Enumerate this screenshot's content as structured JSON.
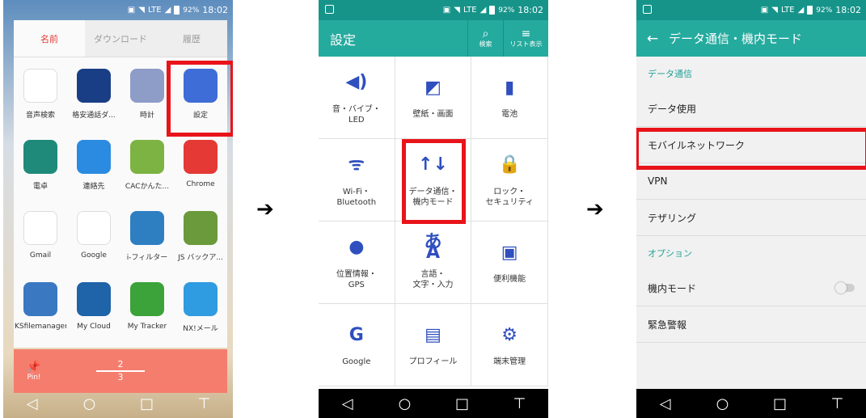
{
  "status": {
    "battery": "92%",
    "time": "18:02",
    "lte": "LTE"
  },
  "screen1": {
    "tabs": [
      "名前",
      "ダウンロード",
      "履歴"
    ],
    "apps": [
      {
        "label": "音声検索",
        "icon": "microphone-icon",
        "color": "#ffffff"
      },
      {
        "label": "格安通話ダ...",
        "icon": "phone-call-icon",
        "color": "#1a3e86"
      },
      {
        "label": "時計",
        "icon": "clock-icon",
        "color": "#8e9cc8"
      },
      {
        "label": "設定",
        "icon": "gear-icon",
        "color": "#3f6dd8"
      },
      {
        "label": "電卓",
        "icon": "calculator-icon",
        "color": "#1f8a7a"
      },
      {
        "label": "連絡先",
        "icon": "contacts-icon",
        "color": "#2b8be0"
      },
      {
        "label": "CACかんた...",
        "icon": "cac-app-icon",
        "color": "#7cb342"
      },
      {
        "label": "Chrome",
        "icon": "chrome-icon",
        "color": "#e53935"
      },
      {
        "label": "Gmail",
        "icon": "gmail-icon",
        "color": "#ffffff"
      },
      {
        "label": "Google",
        "icon": "google-icon",
        "color": "#ffffff"
      },
      {
        "label": "i-フィルター",
        "icon": "i-filter-icon",
        "color": "#2e7fc2"
      },
      {
        "label": "JS バックア...",
        "icon": "js-backup-icon",
        "color": "#6a9a3b"
      },
      {
        "label": "KSfilemanager",
        "icon": "folder-icon",
        "color": "#3a78c2"
      },
      {
        "label": "My Cloud",
        "icon": "cloud-icon",
        "color": "#1f63a8"
      },
      {
        "label": "My Tracker",
        "icon": "tracker-icon",
        "color": "#3ca33a"
      },
      {
        "label": "NX!メール",
        "icon": "mail-icon",
        "color": "#2f9be0"
      }
    ],
    "pin_label": "Pin!",
    "page_top": "2",
    "page_bottom": "3"
  },
  "screen2": {
    "title": "設定",
    "search_label": "検索",
    "list_label": "リスト表示",
    "items": [
      {
        "label": "音・バイブ・\nLED",
        "icon": "speaker-icon",
        "glyph": "◀)"
      },
      {
        "label": "壁紙・画面",
        "icon": "wallpaper-icon",
        "glyph": "◩"
      },
      {
        "label": "電池",
        "icon": "battery-icon",
        "glyph": "▮"
      },
      {
        "label": "Wi-Fi・\nBluetooth",
        "icon": "wifi-bluetooth-icon",
        "glyph": "ᯤ"
      },
      {
        "label": "データ通信・\n機内モード",
        "icon": "data-transfer-icon",
        "glyph": "↑↓"
      },
      {
        "label": "ロック・\nセキュリティ",
        "icon": "lock-icon",
        "glyph": "🔒"
      },
      {
        "label": "位置情報・\nGPS",
        "icon": "location-icon",
        "glyph": "●"
      },
      {
        "label": "言語・\n文字・入力",
        "icon": "language-icon",
        "glyph": "あA"
      },
      {
        "label": "便利機能",
        "icon": "toolbox-icon",
        "glyph": "▣"
      },
      {
        "label": "Google",
        "icon": "google-g-icon",
        "glyph": "G"
      },
      {
        "label": "プロフィール",
        "icon": "profile-card-icon",
        "glyph": "▤"
      },
      {
        "label": "端末管理",
        "icon": "device-admin-icon",
        "glyph": "⚙"
      }
    ]
  },
  "screen3": {
    "title": "データ通信・機内モード",
    "section1": "データ通信",
    "rows1": [
      "データ使用",
      "モバイルネットワーク",
      "VPN",
      "テザリング"
    ],
    "section2": "オプション",
    "airplane": "機内モード",
    "emergency": "緊急警報"
  },
  "accent": "#25aa9e",
  "highlight": "#e8141a"
}
